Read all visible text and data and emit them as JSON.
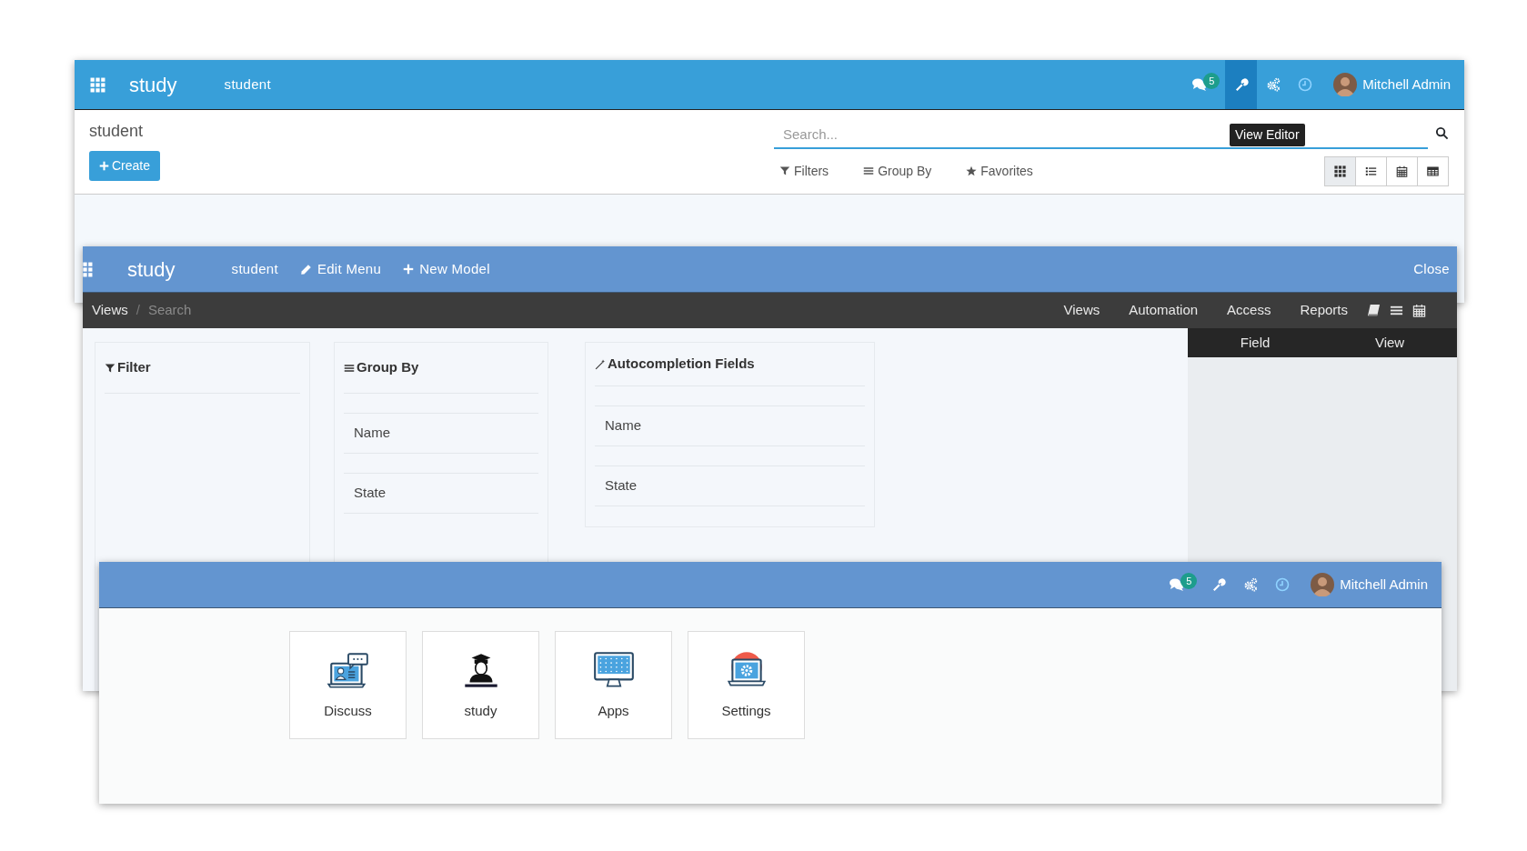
{
  "list_view_window": {
    "navbar": {
      "app_name": "study",
      "menu_items": [
        "student"
      ],
      "systray": {
        "messages_badge": "5",
        "studio_button": {
          "active": true
        },
        "user_name": "Mitchell Admin"
      },
      "tooltip": "View Editor"
    },
    "title": "student",
    "create_button": "Create",
    "search": {
      "placeholder": "Search..."
    },
    "search_options": [
      "Filters",
      "Group By",
      "Favorites"
    ],
    "view_switcher": [
      {
        "selected": true
      },
      {
        "selected": false
      },
      {
        "selected": false
      },
      {
        "selected": false
      }
    ]
  },
  "studio_window": {
    "navbar": {
      "app_name": "study",
      "menu_items": [
        {
          "label": "student",
          "kind": "plain"
        },
        {
          "label": "Edit Menu",
          "kind": "edit"
        },
        {
          "label": "New Model",
          "kind": "add"
        }
      ],
      "close": "Close"
    },
    "breadcrumb_separator": "/",
    "breadcrumb": [
      {
        "label": "Views",
        "current": false
      },
      {
        "label": "Search",
        "current": true
      }
    ],
    "tabs": [
      "Views",
      "Automation",
      "Access",
      "Reports"
    ],
    "panels": [
      {
        "title": "Filter",
        "kind": "filter"
      },
      {
        "title": "Group By",
        "kind": "group_by",
        "items": [
          "Name",
          "State"
        ]
      },
      {
        "title": "Autocompletion Fields",
        "kind": "autocompletion",
        "items": [
          "Name",
          "State"
        ]
      }
    ],
    "sidebar_table": {
      "columns": [
        "Field",
        "View"
      ]
    }
  },
  "home_menu_window": {
    "systray": {
      "messages_badge": "5",
      "studio_button": {
        "active": false
      },
      "user_name": "Mitchell Admin"
    },
    "apps": [
      {
        "label": "Discuss",
        "kind": "discuss"
      },
      {
        "label": "study",
        "kind": "study"
      },
      {
        "label": "Apps",
        "kind": "apps"
      },
      {
        "label": "Settings",
        "kind": "settings"
      }
    ]
  }
}
